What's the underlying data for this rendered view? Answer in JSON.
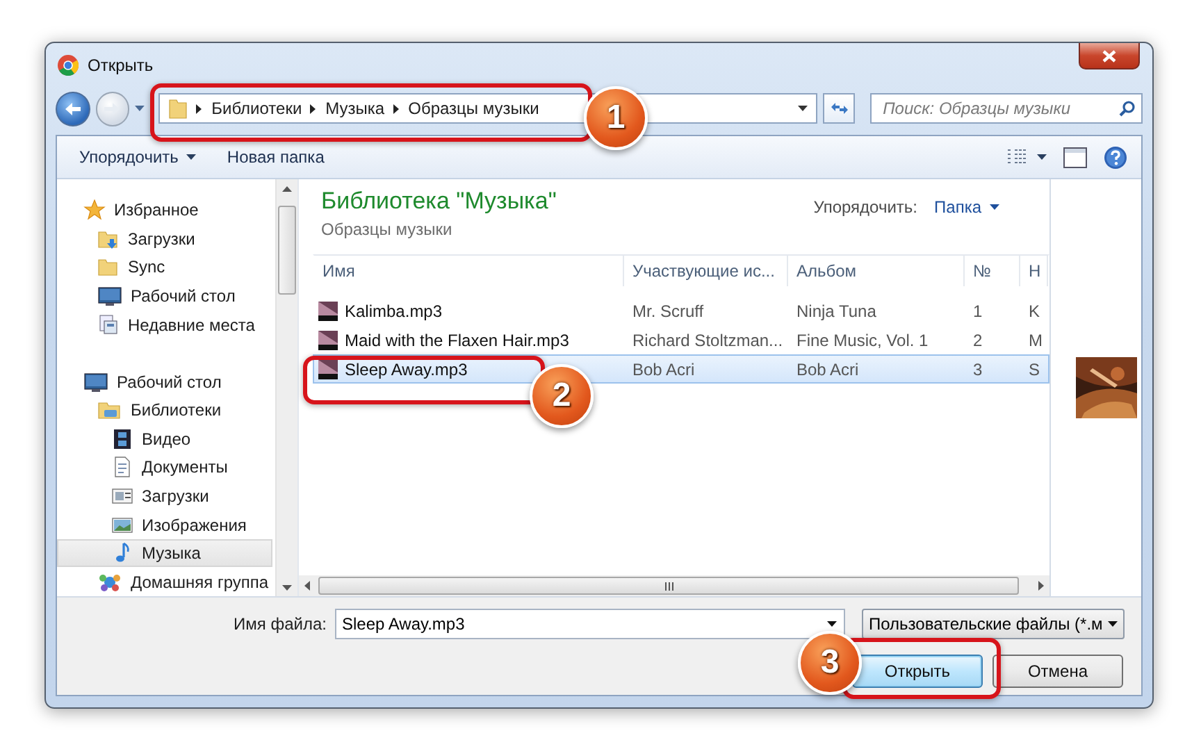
{
  "window": {
    "title": "Открыть"
  },
  "address_bar": {
    "path": [
      "Библиотеки",
      "Музыка",
      "Образцы музыки"
    ]
  },
  "search": {
    "placeholder": "Поиск: Образцы музыки"
  },
  "toolbar": {
    "organize": "Упорядочить",
    "new_folder": "Новая папка"
  },
  "sidebar": {
    "items": [
      {
        "label": "Избранное",
        "selected": false,
        "children": [
          {
            "label": "Загрузки",
            "selected": false
          },
          {
            "label": "Sync",
            "selected": false
          },
          {
            "label": "Рабочий стол",
            "selected": false
          },
          {
            "label": "Недавние места",
            "selected": false
          }
        ]
      },
      {
        "label": "Рабочий стол",
        "selected": false,
        "children": [
          {
            "label": "Библиотеки",
            "selected": false,
            "children": [
              {
                "label": "Видео",
                "selected": false
              },
              {
                "label": "Документы",
                "selected": false
              },
              {
                "label": "Загрузки",
                "selected": false
              },
              {
                "label": "Изображения",
                "selected": false
              },
              {
                "label": "Музыка",
                "selected": true
              }
            ]
          },
          {
            "label": "Домашняя группа",
            "selected": false
          }
        ]
      }
    ]
  },
  "library": {
    "title": "Библиотека \"Музыка\"",
    "subtitle": "Образцы музыки",
    "arrange_label": "Упорядочить:",
    "arrange_value": "Папка"
  },
  "table": {
    "columns": [
      "Имя",
      "Участвующие ис...",
      "Альбом",
      "№",
      "Н"
    ],
    "rows": [
      {
        "cells": [
          "Kalimba.mp3",
          "Mr. Scruff",
          "Ninja Tuna",
          "1",
          "K"
        ],
        "selected": false
      },
      {
        "cells": [
          "Maid with the Flaxen Hair.mp3",
          "Richard Stoltzman...",
          "Fine Music, Vol. 1",
          "2",
          "M"
        ],
        "selected": false
      },
      {
        "cells": [
          "Sleep Away.mp3",
          "Bob Acri",
          "Bob Acri",
          "3",
          "S"
        ],
        "selected": true
      }
    ]
  },
  "footer": {
    "filename_label": "Имя файла:",
    "filename": "Sleep Away.mp3",
    "filter": "Пользовательские файлы (*.м",
    "buttons": [
      {
        "label": "Открыть",
        "kind": "primary"
      },
      {
        "label": "Отмена",
        "kind": "normal"
      }
    ]
  },
  "annotations": [
    {
      "number": "1"
    },
    {
      "number": "2"
    },
    {
      "number": "3"
    }
  ]
}
